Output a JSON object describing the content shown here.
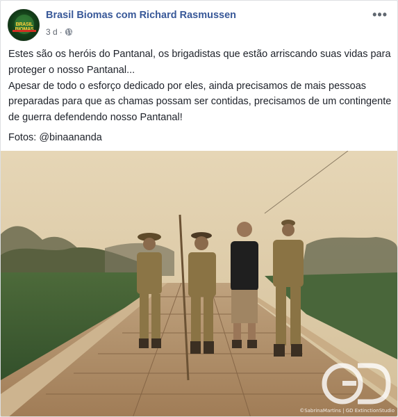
{
  "post": {
    "page_name": "Brasil Biomas com Richard Rasmussen",
    "time": "3 d",
    "separator": "·",
    "more_label": "•••",
    "avatar_text": "BRASIL BIOMAS",
    "paragraphs": [
      "Estes são os heróis do Pantanal, os brigadistas que estão arriscando suas vidas para proteger o nosso Pantanal...",
      "Apesar de todo o esforço dedicado por eles, ainda precisamos de mais pessoas preparadas para que as chamas possam ser contidas, precisamos de um contingente de guerra defendendo nosso Pantanal!"
    ],
    "credit": "Fotos: @binaananda"
  },
  "photo": {
    "watermark_logo": "GD",
    "watermark_text": "©SabrinaMartins | GD ExtinctionStudio"
  },
  "colors": {
    "link_blue": "#385898",
    "meta_gray": "#616770",
    "body_text": "#1d2129",
    "smoke_sky": "#d9c7a2"
  },
  "icons": {
    "privacy": "globe-icon",
    "menu": "more-options-icon"
  }
}
